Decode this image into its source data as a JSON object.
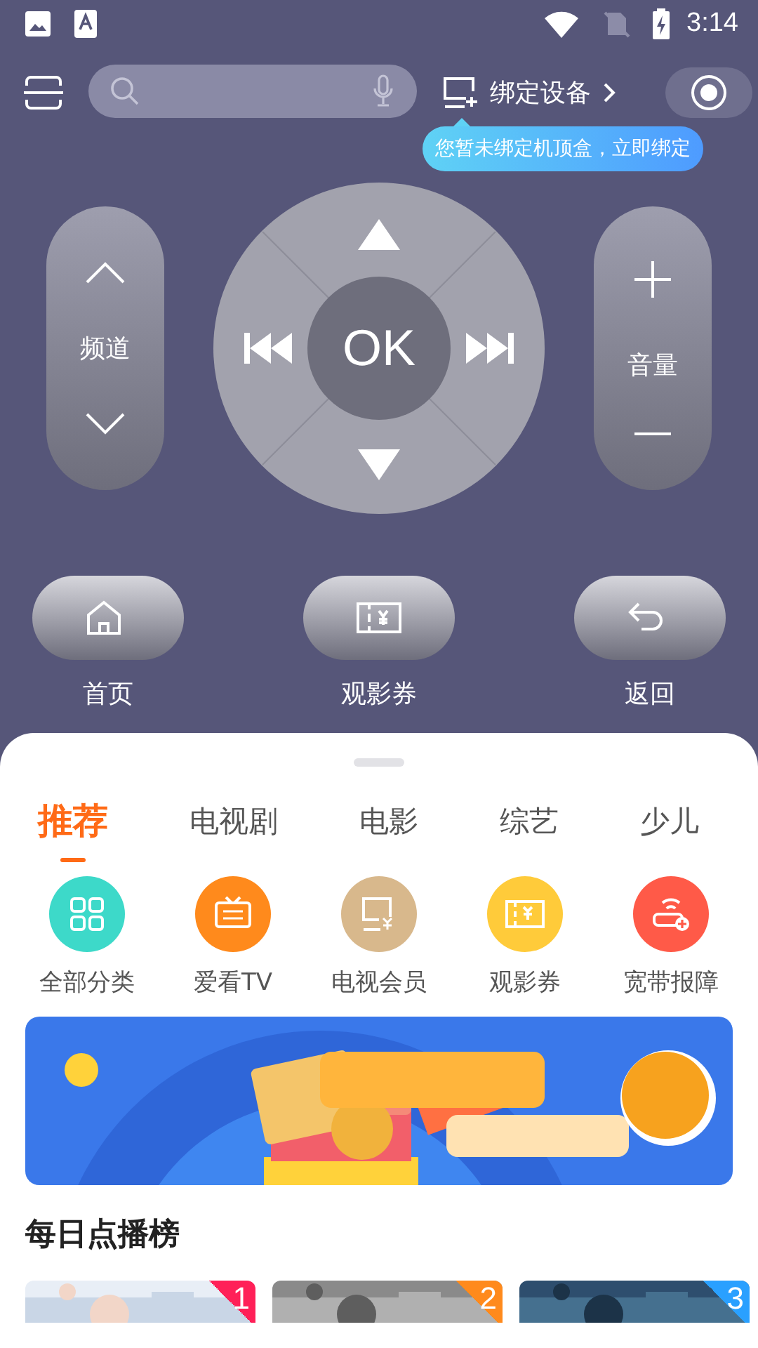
{
  "status_bar": {
    "time": "3:14"
  },
  "top_bar": {
    "bind_device": "绑定设备",
    "tooltip": "您暂未绑定机顶盒，立即绑定"
  },
  "remote": {
    "channel": "频道",
    "ok": "OK",
    "volume": "音量"
  },
  "shortcuts": [
    {
      "label": "首页",
      "kind": "home"
    },
    {
      "label": "观影券",
      "kind": "ticket"
    },
    {
      "label": "返回",
      "kind": "back"
    }
  ],
  "tabs": [
    {
      "label": "推荐",
      "selected": true
    },
    {
      "label": "电视剧",
      "selected": false
    },
    {
      "label": "电影",
      "selected": false
    },
    {
      "label": "综艺",
      "selected": false
    },
    {
      "label": "少儿",
      "selected": false
    }
  ],
  "categories": [
    {
      "label": "全部分类",
      "kind": "grid",
      "color": "#3dd9c9"
    },
    {
      "label": "爱看TV",
      "kind": "tv",
      "color": "#ff8a1c"
    },
    {
      "label": "电视会员",
      "kind": "member",
      "color": "#d8b88c"
    },
    {
      "label": "观影券",
      "kind": "ticket",
      "color": "#ffcb3a"
    },
    {
      "label": "宽带报障",
      "kind": "router",
      "color": "#ff5a48"
    }
  ],
  "ranking": {
    "title": "每日点播榜",
    "items": [
      {
        "rank": "1",
        "color": "#ff2058"
      },
      {
        "rank": "2",
        "color": "#ff8a1c"
      },
      {
        "rank": "3",
        "color": "#2aa0ff"
      }
    ]
  }
}
